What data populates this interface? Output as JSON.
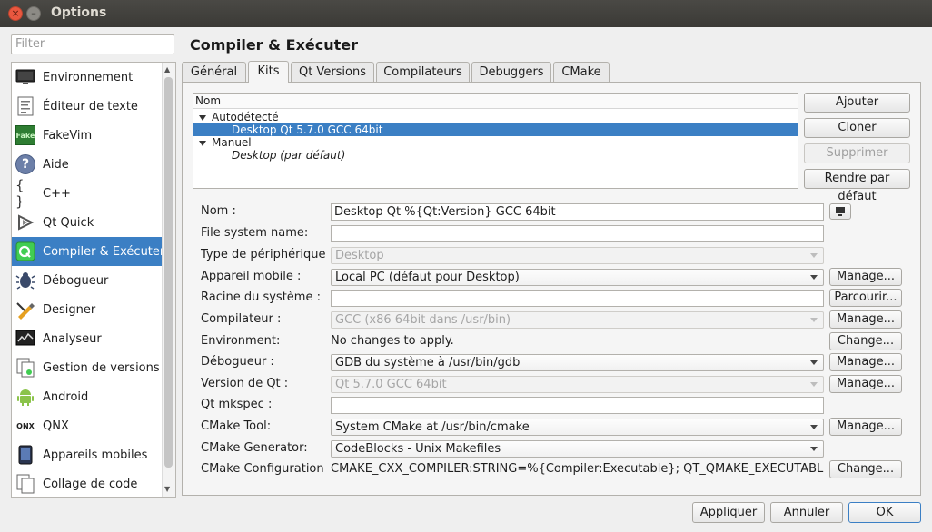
{
  "window": {
    "title": "Options",
    "close_glyph": "×",
    "min_glyph": "–"
  },
  "filter": {
    "placeholder": "Filter"
  },
  "categories": [
    {
      "label": "Environnement",
      "icon": "monitor-icon"
    },
    {
      "label": "Éditeur de texte",
      "icon": "text-editor-icon"
    },
    {
      "label": "FakeVim",
      "icon": "fakevim-icon"
    },
    {
      "label": "Aide",
      "icon": "help-icon"
    },
    {
      "label": "C++",
      "icon": "cpp-braces-icon"
    },
    {
      "label": "Qt Quick",
      "icon": "qt-quick-icon"
    },
    {
      "label": "Compiler & Exécuter",
      "icon": "build-run-icon"
    },
    {
      "label": "Débogueur",
      "icon": "debugger-bug-icon"
    },
    {
      "label": "Designer",
      "icon": "designer-icon"
    },
    {
      "label": "Analyseur",
      "icon": "analyzer-icon"
    },
    {
      "label": "Gestion de versions",
      "icon": "version-control-icon"
    },
    {
      "label": "Android",
      "icon": "android-icon"
    },
    {
      "label": "QNX",
      "icon": "qnx-icon"
    },
    {
      "label": "Appareils mobiles",
      "icon": "mobile-device-icon"
    },
    {
      "label": "Collage de code",
      "icon": "code-paste-icon"
    }
  ],
  "icon_glyphs": {
    "help": "?",
    "cpp": "{ }",
    "fakevim": "Fake",
    "qnx": "QNX"
  },
  "page": {
    "title": "Compiler & Exécuter"
  },
  "tabs": [
    "Général",
    "Kits",
    "Qt Versions",
    "Compilateurs",
    "Debuggers",
    "CMake"
  ],
  "kits_tree": {
    "header": "Nom",
    "groups": [
      {
        "label": "Autodétecté",
        "items": [
          "Desktop Qt 5.7.0 GCC 64bit"
        ]
      },
      {
        "label": "Manuel",
        "items": [
          "Desktop (par défaut)"
        ]
      }
    ]
  },
  "kit_buttons": {
    "add": "Ajouter",
    "clone": "Cloner",
    "remove": "Supprimer",
    "make_default": "Rendre par défaut"
  },
  "form": {
    "name": {
      "label": "Nom :",
      "value": "Desktop Qt %{Qt:Version} GCC 64bit"
    },
    "fs_name": {
      "label": "File system name:",
      "value": ""
    },
    "device_type": {
      "label": "Type de périphérique :",
      "value": "Desktop"
    },
    "device": {
      "label": "Appareil mobile :",
      "value": "Local PC (défaut pour Desktop)",
      "button": "Manage..."
    },
    "sysroot": {
      "label": "Racine du système :",
      "value": "",
      "button": "Parcourir..."
    },
    "compiler": {
      "label": "Compilateur :",
      "value": "GCC (x86 64bit dans /usr/bin)",
      "button": "Manage..."
    },
    "environment": {
      "label": "Environment:",
      "value": "No changes to apply.",
      "button": "Change..."
    },
    "debugger": {
      "label": "Débogueur :",
      "value": "GDB du système à /usr/bin/gdb",
      "button": "Manage..."
    },
    "qt_version": {
      "label": "Version de Qt :",
      "value": "Qt 5.7.0 GCC 64bit",
      "button": "Manage..."
    },
    "qt_mkspec": {
      "label": "Qt mkspec :",
      "value": ""
    },
    "cmake_tool": {
      "label": "CMake Tool:",
      "value": "System CMake at /usr/bin/cmake",
      "button": "Manage..."
    },
    "cmake_generator": {
      "label": "CMake Generator:",
      "value": "CodeBlocks - Unix Makefiles"
    },
    "cmake_config": {
      "label": "CMake Configuration",
      "value": "CMAKE_CXX_COMPILER:STRING=%{Compiler:Executable}; QT_QMAKE_EXECUTABLE:ST...",
      "button": "Change..."
    }
  },
  "footer": {
    "apply": "Appliquer",
    "cancel": "Annuler",
    "ok": "OK"
  }
}
